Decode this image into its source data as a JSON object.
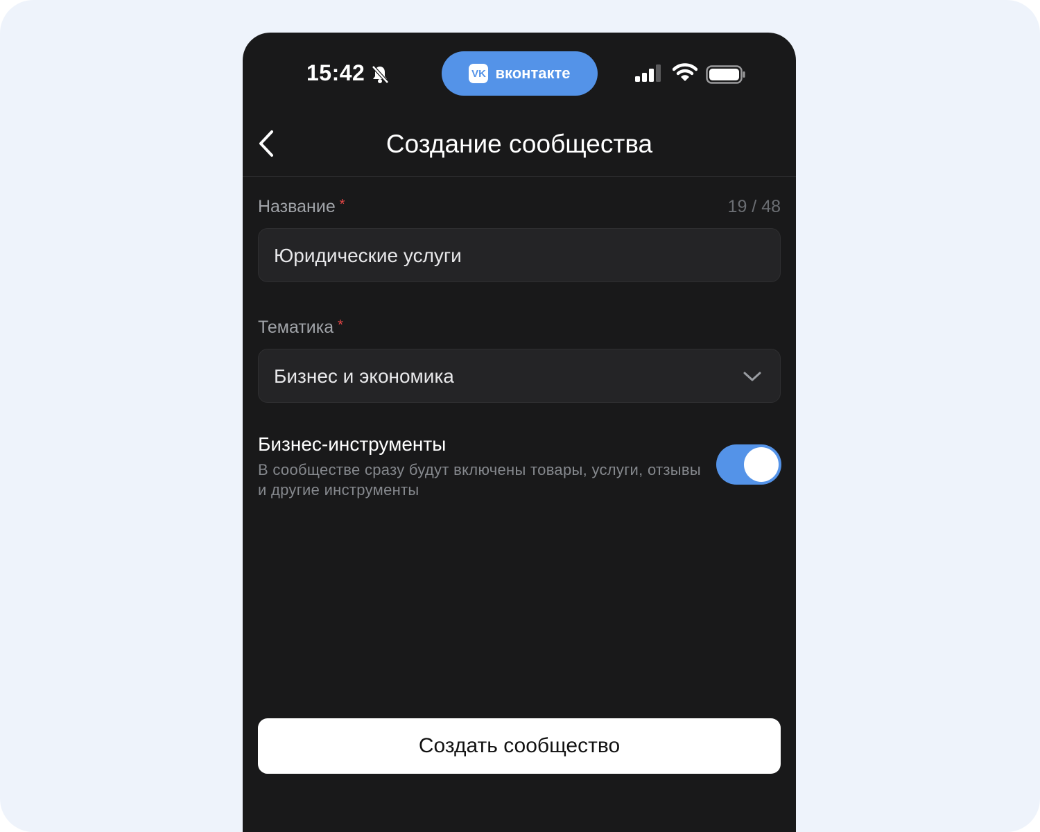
{
  "status_bar": {
    "time": "15:42",
    "app_pill_label": "вконтакте",
    "app_logo_text": "VK"
  },
  "header": {
    "title": "Создание сообщества"
  },
  "form": {
    "name": {
      "label": "Название",
      "required_mark": "*",
      "counter": "19 / 48",
      "value": "Юридические услуги"
    },
    "topic": {
      "label": "Тематика",
      "required_mark": "*",
      "value": "Бизнес и экономика"
    },
    "business_tools": {
      "title": "Бизнес-инструменты",
      "description": "В сообществе сразу будут включены товары, услуги, отзывы и другие инструменты",
      "enabled": true
    }
  },
  "actions": {
    "create_label": "Создать сообщество"
  },
  "colors": {
    "accent": "#5493e8",
    "background": "#19191a",
    "required": "#e64646"
  },
  "icons": [
    "bell-muted-icon",
    "vk-logo-icon",
    "cellular-signal-icon",
    "wifi-icon",
    "battery-icon",
    "back-chevron-icon",
    "chevron-down-icon"
  ]
}
